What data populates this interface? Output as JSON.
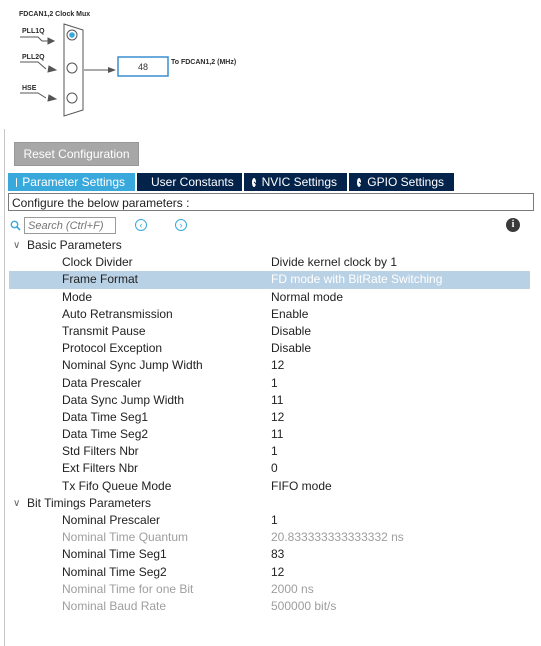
{
  "clock_mux": {
    "title": "FDCAN1,2 Clock Mux",
    "inputs": [
      {
        "label": "PLL1Q",
        "selected": true
      },
      {
        "label": "PLL2Q",
        "selected": false
      },
      {
        "label": "HSE",
        "selected": false
      }
    ],
    "output_value": "48",
    "output_label": "To FDCAN1,2 (MHz)"
  },
  "toolbar": {
    "reset_label": "Reset Configuration"
  },
  "tabs": [
    {
      "label": "Parameter Settings",
      "active": true
    },
    {
      "label": "User Constants",
      "active": false
    },
    {
      "label": "NVIC Settings",
      "active": false
    },
    {
      "label": "GPIO Settings",
      "active": false
    }
  ],
  "configure_text": "Configure the below parameters :",
  "search": {
    "placeholder": "Search (Ctrl+F)"
  },
  "groups": [
    {
      "title": "Basic Parameters",
      "params": [
        {
          "name": "Clock Divider",
          "value": "Divide kernel clock by 1"
        },
        {
          "name": "Frame Format",
          "value": "FD mode with BitRate Switching",
          "selected": true
        },
        {
          "name": "Mode",
          "value": "Normal mode"
        },
        {
          "name": "Auto Retransmission",
          "value": "Enable"
        },
        {
          "name": "Transmit Pause",
          "value": "Disable"
        },
        {
          "name": "Protocol Exception",
          "value": "Disable"
        },
        {
          "name": "Nominal Sync Jump Width",
          "value": "12"
        },
        {
          "name": "Data Prescaler",
          "value": "1"
        },
        {
          "name": "Data Sync Jump Width",
          "value": "11"
        },
        {
          "name": "Data Time Seg1",
          "value": "12"
        },
        {
          "name": "Data Time Seg2",
          "value": "11"
        },
        {
          "name": "Std Filters Nbr",
          "value": "1"
        },
        {
          "name": "Ext Filters Nbr",
          "value": "0"
        },
        {
          "name": "Tx Fifo Queue Mode",
          "value": "FIFO mode"
        }
      ]
    },
    {
      "title": "Bit Timings Parameters",
      "params": [
        {
          "name": "Nominal Prescaler",
          "value": "1"
        },
        {
          "name": "Nominal Time Quantum",
          "value": "20.833333333333332 ns",
          "disabled": true
        },
        {
          "name": "Nominal Time Seg1",
          "value": "83"
        },
        {
          "name": "Nominal Time Seg2",
          "value": "12"
        },
        {
          "name": "Nominal Time for one Bit",
          "value": "2000 ns",
          "disabled": true
        },
        {
          "name": "Nominal Baud Rate",
          "value": "500000 bit/s",
          "disabled": true
        }
      ]
    }
  ],
  "colors": {
    "tab_active": "#39a9db",
    "tab_inactive": "#03234b",
    "selection": "#b9d1e5",
    "disabled_text": "#9e9e9e"
  }
}
